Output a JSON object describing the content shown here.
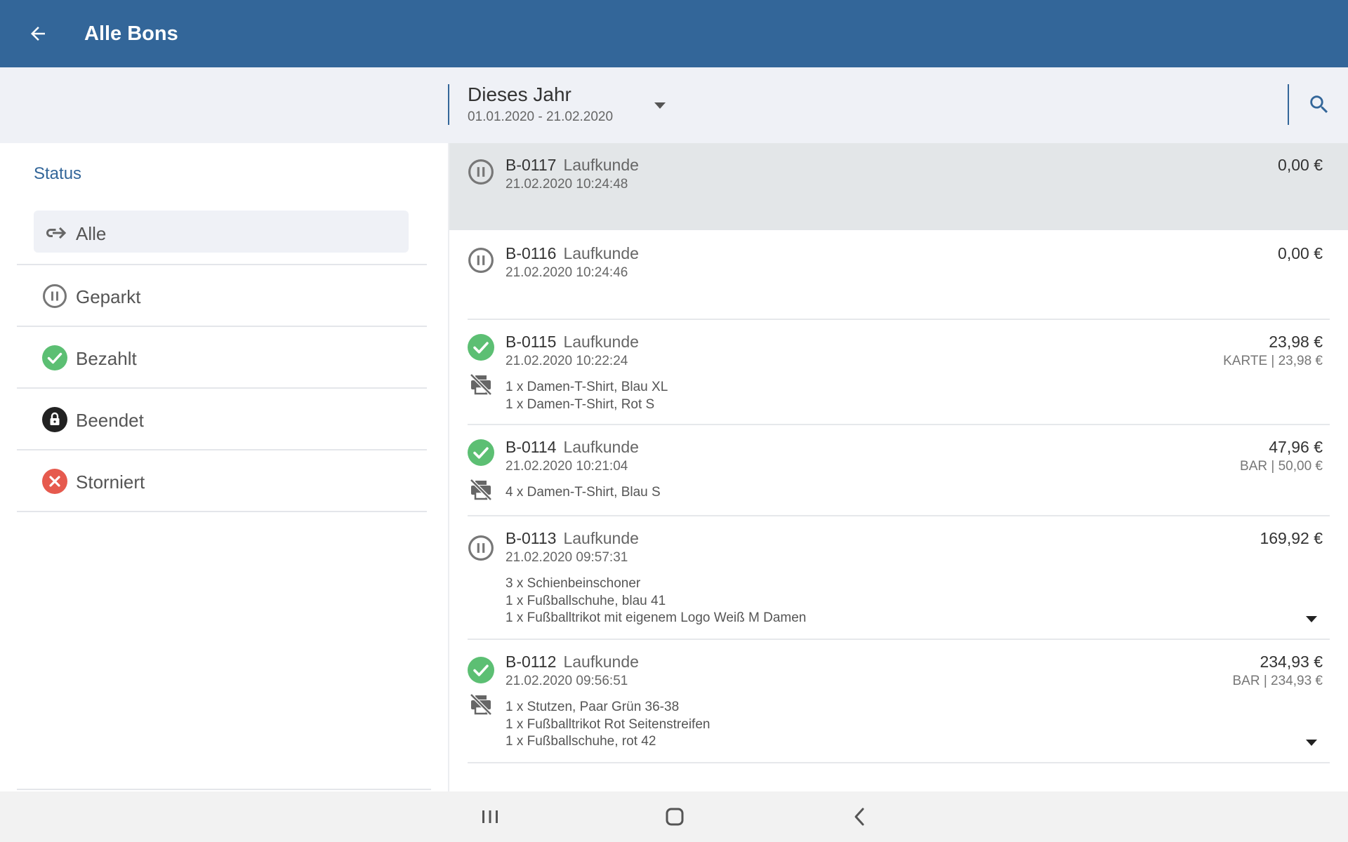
{
  "header": {
    "title": "Alle Bons",
    "back_icon": "arrow-left-icon"
  },
  "filter": {
    "period_title": "Dieses Jahr",
    "period_range": "01.01.2020 - 21.02.2020",
    "search_icon": "search-icon"
  },
  "sidebar": {
    "heading": "Status",
    "items": [
      {
        "label": "Alle",
        "icon": "link-icon",
        "selected": true
      },
      {
        "label": "Geparkt",
        "icon": "pause-circle-icon"
      },
      {
        "label": "Bezahlt",
        "icon": "check-circle-icon"
      },
      {
        "label": "Beendet",
        "icon": "lock-icon"
      },
      {
        "label": "Storniert",
        "icon": "cancel-circle-icon"
      }
    ]
  },
  "receipts": [
    {
      "number": "B-0117",
      "customer": "Laufkunde",
      "datetime": "21.02.2020 10:24:48",
      "amount": "0,00 €",
      "payment": "",
      "status": "geparkt",
      "items": []
    },
    {
      "number": "B-0116",
      "customer": "Laufkunde",
      "datetime": "21.02.2020 10:24:46",
      "amount": "0,00 €",
      "payment": "",
      "status": "geparkt",
      "items": []
    },
    {
      "number": "B-0115",
      "customer": "Laufkunde",
      "datetime": "21.02.2020 10:22:24",
      "amount": "23,98 €",
      "payment": "KARTE | 23,98 €",
      "status": "bezahlt",
      "items": [
        "1 x  Damen-T-Shirt, Blau XL",
        "1 x  Damen-T-Shirt, Rot S"
      ]
    },
    {
      "number": "B-0114",
      "customer": "Laufkunde",
      "datetime": "21.02.2020 10:21:04",
      "amount": "47,96 €",
      "payment": "BAR | 50,00 €",
      "status": "bezahlt",
      "items": [
        "4 x  Damen-T-Shirt, Blau S"
      ]
    },
    {
      "number": "B-0113",
      "customer": "Laufkunde",
      "datetime": "21.02.2020 09:57:31",
      "amount": "169,92 €",
      "payment": "",
      "status": "geparkt",
      "items": [
        "3 x  Schienbeinschoner",
        "1 x  Fußballschuhe, blau 41",
        "1 x  Fußballtrikot mit eigenem Logo Weiß M Damen"
      ]
    },
    {
      "number": "B-0112",
      "customer": "Laufkunde",
      "datetime": "21.02.2020 09:56:51",
      "amount": "234,93 €",
      "payment": "BAR | 234,93 €",
      "status": "bezahlt",
      "items": [
        "1 x  Stutzen, Paar Grün 36-38",
        "1 x  Fußballtrikot Rot Seitenstreifen",
        "1 x  Fußballschuhe, rot 42"
      ]
    }
  ],
  "colors": {
    "primary": "#336699",
    "paid": "#5cbf73",
    "cancelled": "#e65a4e",
    "parked": "#777777",
    "selected_row": "#e3e6e8"
  },
  "navbar": {
    "icons": [
      "recent-apps-icon",
      "home-icon",
      "back-icon"
    ]
  }
}
